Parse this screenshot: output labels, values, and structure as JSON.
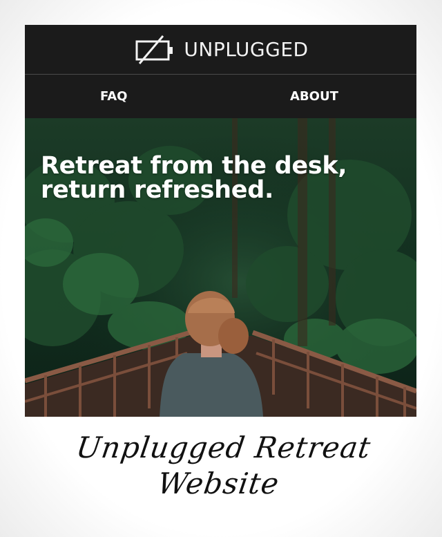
{
  "header": {
    "brand_name": "UNPLUGGED",
    "brand_icon": "unplugged-battery-icon"
  },
  "nav": {
    "items": [
      {
        "label": "FAQ"
      },
      {
        "label": "ABOUT"
      }
    ]
  },
  "hero": {
    "headline_line1": "Retreat from the desk,",
    "headline_line2": "return refreshed."
  },
  "caption": {
    "line1": "Unplugged Retreat",
    "line2": "Website"
  },
  "colors": {
    "header_bg": "#1b1b1b",
    "text_light": "#ffffff",
    "forest_dark": "#10281a",
    "bridge_rail": "#8a5a45",
    "caption_ink": "#111111"
  }
}
